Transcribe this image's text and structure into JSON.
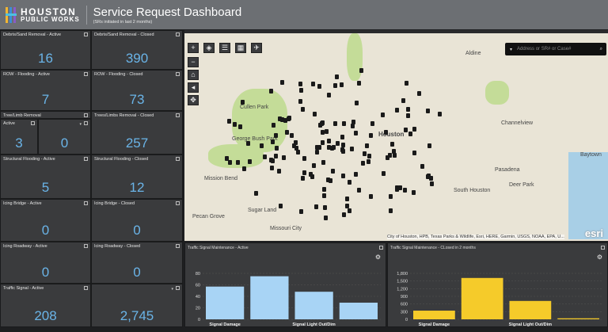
{
  "header": {
    "logo_line1": "HOUSTON",
    "logo_line2": "PUBLIC WORKS",
    "title": "Service Request Dashboard",
    "subtitle": "(SRs initiated in last 2 months)"
  },
  "tiles": [
    {
      "label": "Debris/Sand Removal - Active",
      "value": "16"
    },
    {
      "label": "Debris/Sand Removal - Closed",
      "value": "390"
    },
    {
      "label": "ROW - Flooding - Active",
      "value": "7"
    },
    {
      "label": "ROW - Flooding - Closed",
      "value": "73"
    },
    {
      "label": "Tree/Limb Removal",
      "value": ""
    },
    {
      "label": "Active",
      "value": "3"
    },
    {
      "label": "",
      "value": "0"
    },
    {
      "label": "Trees/Limbs Removal - Closed",
      "value": "257"
    },
    {
      "label": "Structural Flooding - Active",
      "value": "5"
    },
    {
      "label": "Structural Flooding - Closed",
      "value": "12"
    },
    {
      "label": "Icing Bridge - Active",
      "value": "0"
    },
    {
      "label": "Icing Bridge - Closed",
      "value": "0"
    },
    {
      "label": "Icing Roadway - Active",
      "value": "0"
    },
    {
      "label": "Icing Roadway - Closed",
      "value": "0"
    },
    {
      "label": "Traffic Signal - Active",
      "value": "208"
    },
    {
      "label": "",
      "value": "2,745"
    }
  ],
  "map": {
    "search_placeholder": "Address or SR# or Case#",
    "attribution": "City of Houston, HPB, Texas Parks & Wildlife, Esri, HERE, Garmin, USGS, NOAA, EPA, U...",
    "esri": "esri",
    "labels": [
      "Houston",
      "Pasadena",
      "Deer Park",
      "Baytown",
      "Sugar Land",
      "Missouri City",
      "South Houston",
      "Mission Bend",
      "Channelview",
      "Pecan Grove",
      "Cullen Park",
      "George Bush Park",
      "Aldine"
    ]
  },
  "chart_data": [
    {
      "type": "bar",
      "title": "Traffic Signal Maintenance - Active",
      "categories": [
        "Signal Damage",
        "",
        "Signal Light Out/Dim",
        ""
      ],
      "values": [
        57,
        75,
        48,
        29
      ],
      "ylim": [
        0,
        80
      ],
      "ticks": [
        "0",
        "20",
        "40",
        "60",
        "80"
      ],
      "color": "#a8d4f5"
    },
    {
      "type": "bar",
      "title": "Traffic Signal Maintenance - CLosed in 2 months",
      "categories": [
        "Signal Damage",
        "",
        "Signal Light Out/Dim",
        ""
      ],
      "values": [
        340,
        1620,
        720,
        40
      ],
      "ylim": [
        0,
        1800
      ],
      "ticks": [
        "0",
        "300",
        "600",
        "900",
        "1,200",
        "1,500",
        "1,800"
      ],
      "color": "#f5cb2a"
    }
  ]
}
